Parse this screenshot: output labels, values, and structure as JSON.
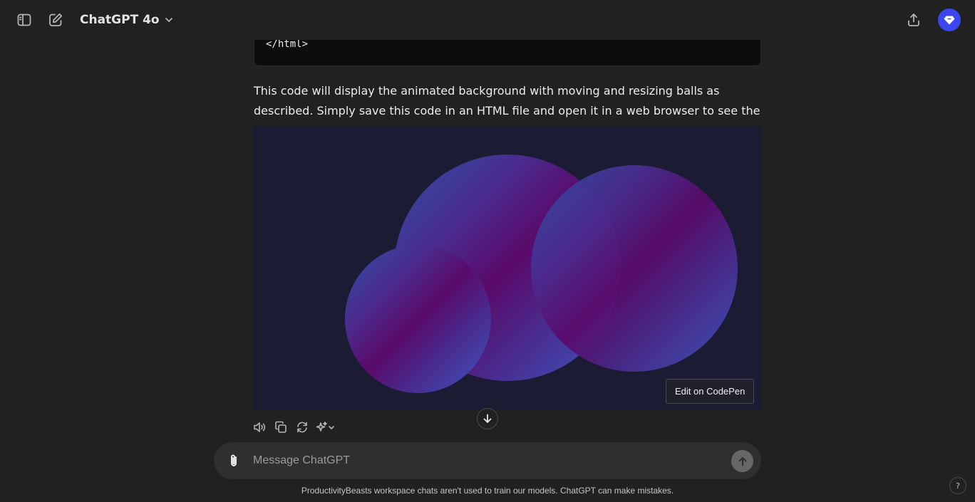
{
  "header": {
    "model_name": "ChatGPT 4o",
    "icons": [
      "sidebar-toggle-icon",
      "new-chat-icon",
      "chevron-down-icon",
      "share-icon",
      "avatar-diamond-icon"
    ]
  },
  "code_block": {
    "last_line": "</html>"
  },
  "message": {
    "text": "This code will display the animated background with moving and resizing balls as described. Simply save this code in an HTML file and open it in a web browser to see the animation."
  },
  "preview": {
    "codepen_label": "Edit on CodePen",
    "background_color": "#1b1c33"
  },
  "actions": {
    "icons": [
      "read-aloud-icon",
      "copy-icon",
      "regenerate-icon",
      "model-switch-icon"
    ]
  },
  "composer": {
    "placeholder": "Message ChatGPT"
  },
  "footer": {
    "disclaimer": "ProductivityBeasts workspace chats aren't used to train our models. ChatGPT can make mistakes.",
    "help_label": "?"
  },
  "colors": {
    "background": "#212121",
    "avatar": "#3b46ee",
    "composer": "#2f2f2f"
  }
}
